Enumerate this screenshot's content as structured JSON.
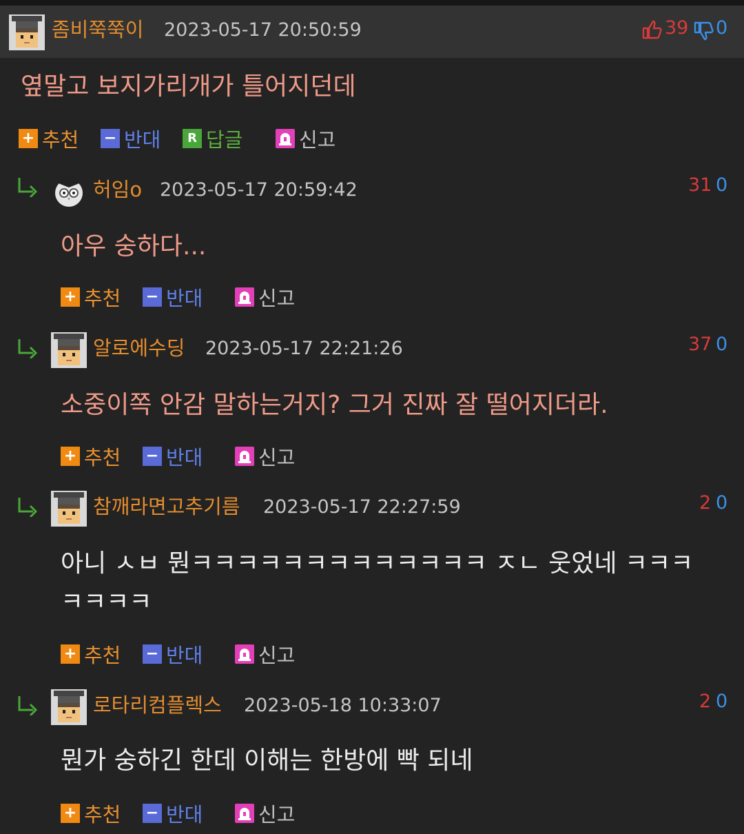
{
  "post": {
    "nick": "좀비쭉쭉이",
    "date": "2023-05-17 20:50:59",
    "up": "39",
    "down": "0",
    "text": "옆말고 보지가리개가 틀어지던데"
  },
  "actions": {
    "recommend": "추천",
    "oppose": "반대",
    "reply": "답글",
    "report": "신고"
  },
  "replies": [
    {
      "nick": "허임o",
      "date": "2023-05-17 20:59:42",
      "up": "31",
      "down": "0",
      "lines": [
        "아우 숭하다..."
      ]
    },
    {
      "nick": "알로에수딩",
      "date": "2023-05-17 22:21:26",
      "up": "37",
      "down": "0",
      "lines": [
        "소중이쪽 안감 말하는거지? 그거 진짜 잘 떨어지더라."
      ]
    },
    {
      "nick": "참깨라면고추기름",
      "date": "2023-05-17 22:27:59",
      "up": "2",
      "down": "0",
      "lines": [
        "아니 ㅅㅂ 뭔ㅋㅋㅋㅋㅋㅋㅋㅋㅋㅋㅋㅋㅋ ㅈㄴ 웃었네 ㅋㅋㅋ",
        "ㅋㅋㅋㅋ"
      ]
    },
    {
      "nick": "로타리컴플렉스",
      "date": "2023-05-18 10:33:07",
      "up": "2",
      "down": "0",
      "lines": [
        "뭔가 숭하긴 한데 이해는 한방에 빡 되네"
      ]
    }
  ],
  "colors": {
    "nick": "#e38d2e",
    "up": "#d83a3a",
    "down": "#3b8fe8",
    "body": "#ef9a88",
    "body_white": "#ececec"
  },
  "icons": [
    "thumb-up-icon",
    "thumb-down-icon",
    "plus-icon",
    "minus-icon",
    "reply-r-icon",
    "siren-icon",
    "reply-arrow-icon",
    "pixel-avatar",
    "owl-avatar"
  ]
}
